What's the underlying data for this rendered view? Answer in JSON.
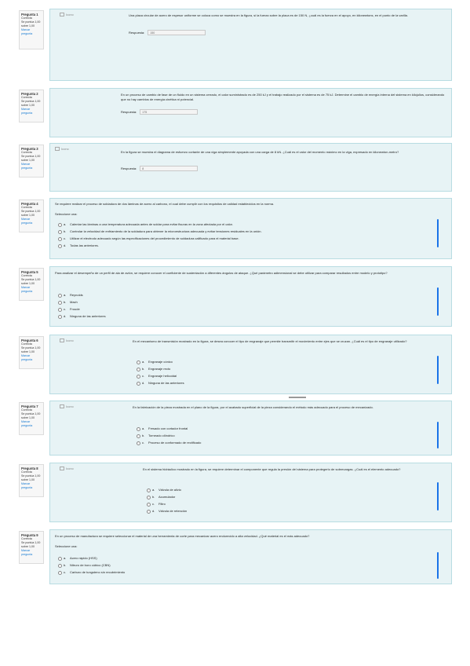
{
  "questions": [
    {
      "info": {
        "label": "Pregunta 1",
        "status": "Correcta",
        "score": "Se puntúa 1,00 sobre 1,00",
        "flag": "Marcar pregunta"
      },
      "image_alt": "Icono",
      "text": "Una placa circular de acero de espesor uniforme se coloca como se muestra en la figura, si la fuerza sobre la placa es de 150 N, ¿cuál es la fuerza en el apoyo, en kilonewtons, en el punto de la varilla.",
      "answer_label": "Respuesta:",
      "answer_value": "150"
    },
    {
      "info": {
        "label": "Pregunta 2",
        "status": "Correcta",
        "score": "Se puntúa 1,00 sobre 1,00",
        "flag": "Marcar pregunta"
      },
      "text": "En un proceso de cambio de fase de un fluido en un sistema cerrado, el calor suministrado es de 250 kJ y el trabajo realizado por el sistema es de 75 kJ. Determine el cambio de energía interna del sistema en kilojulios, considerando que no hay cambios de energía cinética ni potencial.",
      "answer_label": "Respuesta:",
      "answer_value": "175"
    },
    {
      "info": {
        "label": "Pregunta 3",
        "status": "Correcta",
        "score": "Se puntúa 1,00 sobre 1,00",
        "flag": "Marcar pregunta"
      },
      "image_alt": "Icono",
      "text": "En la figura se muestra el diagrama de esfuerzo cortante de una viga simplemente apoyada con una carga de 8 kN. ¿Cuál es el valor del momento máximo en la viga, expresado en kilonewton-metro?",
      "answer_label": "Respuesta:",
      "answer_value": "8"
    },
    {
      "info": {
        "label": "Pregunta 4",
        "status": "Correcta",
        "score": "Se puntúa 1,00 sobre 1,00",
        "flag": "Marcar pregunta"
      },
      "text": "Se requiere realizar el proceso de soldadura de dos láminas de acero al carbono, el cual debe cumplir con los requisitos de calidad establecidos en la norma.",
      "select_label": "Seleccione una:",
      "options": [
        {
          "letter": "a.",
          "text": "Calentar las láminas a una temperatura adecuada antes de soldar para evitar fisuras en la zona afectada por el calor."
        },
        {
          "letter": "b.",
          "text": "Controlar la velocidad de enfriamiento de la soldadura para obtener la microestructura adecuada y evitar tensiones residuales en la unión."
        },
        {
          "letter": "c.",
          "text": "Utilizar el electrodo adecuado según las especificaciones del procedimiento de soldadura calificado para el material base."
        },
        {
          "letter": "d.",
          "text": "Todas las anteriores."
        }
      ]
    },
    {
      "info": {
        "label": "Pregunta 5",
        "status": "Correcta",
        "score": "Se puntúa 1,00 sobre 1,00",
        "flag": "Marcar pregunta"
      },
      "text": "Para analizar el desempeño de un perfil de ala de avión, se requiere conocer el coeficiente de sustentación a diferentes ángulos de ataque. ¿Qué parámetro adimensional se debe utilizar para comparar resultados entre modelo y prototipo?",
      "options": [
        {
          "letter": "a.",
          "text": "Reynolds"
        },
        {
          "letter": "b.",
          "text": "Mach"
        },
        {
          "letter": "c.",
          "text": "Froude"
        },
        {
          "letter": "d.",
          "text": "Ninguna de las anteriores"
        }
      ]
    },
    {
      "info": {
        "label": "Pregunta 6",
        "status": "Correcta",
        "score": "Se puntúa 1,00 sobre 1,00",
        "flag": "Marcar pregunta"
      },
      "image_alt": "Icono",
      "text": "En el mecanismo de transmisión mostrado en la figura, se desea conocer el tipo de engranaje que permite transmitir el movimiento entre ejes que se cruzan. ¿Cuál es el tipo de engranaje utilizado?",
      "options": [
        {
          "letter": "a.",
          "text": "Engranaje cónico"
        },
        {
          "letter": "b.",
          "text": "Engranaje recto"
        },
        {
          "letter": "c.",
          "text": "Engranaje helicoidal"
        },
        {
          "letter": "d.",
          "text": "Ninguna de las anteriores"
        }
      ]
    },
    {
      "info": {
        "label": "Pregunta 7",
        "status": "Correcta",
        "score": "Se puntúa 1,00 sobre 1,00",
        "flag": "Marcar pregunta"
      },
      "image_alt": "Icono",
      "text": "En la fabricación de la pieza mostrada en el plano de la figura, por el acabado superficial de la pieza considerando el método más adecuado para el proceso de mecanizado.",
      "options": [
        {
          "letter": "a.",
          "text": "Fresado con cortador frontal"
        },
        {
          "letter": "b.",
          "text": "Torneado cilíndrico"
        },
        {
          "letter": "c.",
          "text": "Proceso de conformado de rectificado"
        }
      ]
    },
    {
      "info": {
        "label": "Pregunta 8",
        "status": "Correcta",
        "score": "Se puntúa 1,00 sobre 1,00",
        "flag": "Marcar pregunta"
      },
      "image_alt": "Icono",
      "text": "En el sistema hidráulico mostrado en la figura, se requiere determinar el componente que regula la presión del sistema para protegerlo de sobrecargas. ¿Cuál es el elemento adecuado?",
      "options": [
        {
          "letter": "a.",
          "text": "Válvula de alivio"
        },
        {
          "letter": "b.",
          "text": "Acumulador"
        },
        {
          "letter": "c.",
          "text": "Filtro"
        },
        {
          "letter": "d.",
          "text": "Válvula de retención"
        }
      ]
    },
    {
      "info": {
        "label": "Pregunta 9",
        "status": "Correcta",
        "score": "Se puntúa 1,00 sobre 1,00",
        "flag": "Marcar pregunta"
      },
      "text": "En un proceso de manufactura se requiere seleccionar el material de una herramienta de corte para mecanizar acero endurecido a alta velocidad. ¿Qué material es el más adecuado?",
      "select_label": "Seleccione una:",
      "options": [
        {
          "letter": "a.",
          "text": "Acero rápido (HSS)"
        },
        {
          "letter": "b.",
          "text": "Nitruro de boro cúbico (CBN)"
        },
        {
          "letter": "c.",
          "text": "Carburo de tungsteno sin recubrimiento"
        }
      ]
    }
  ]
}
